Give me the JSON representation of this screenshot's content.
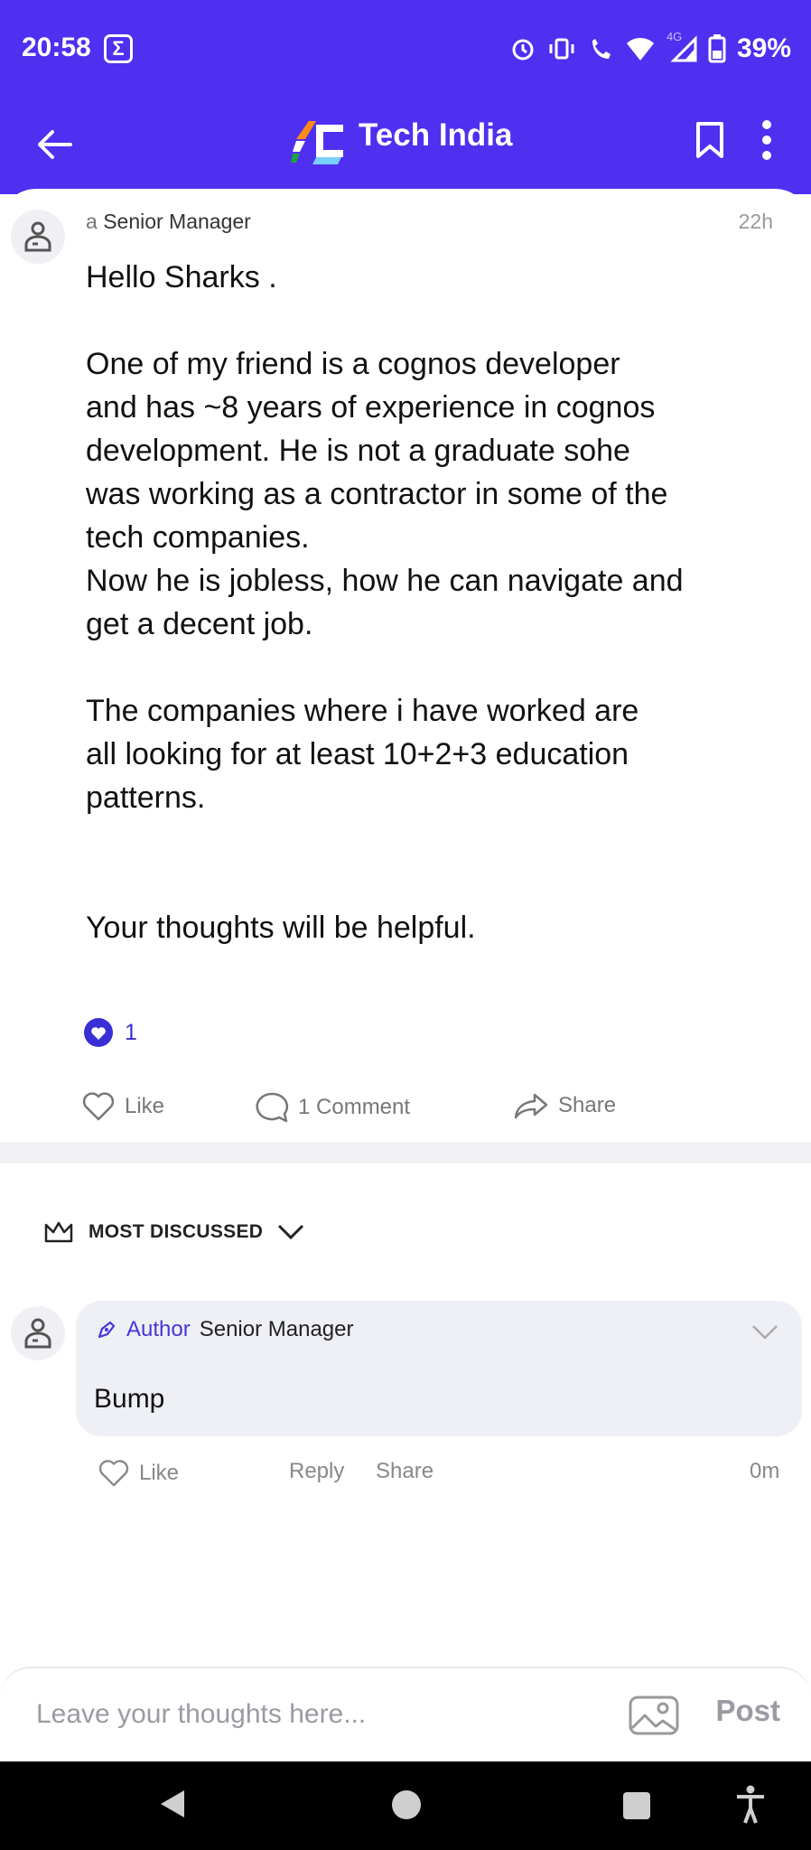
{
  "status_bar": {
    "time": "20:58",
    "notification_icon": "sigma-icon",
    "notification_glyph": "Σ",
    "network_label": "4G",
    "battery": "39%",
    "icons": [
      "alarm-icon",
      "vibrate-icon",
      "wifi-call-icon",
      "wifi-icon",
      "signal-icon",
      "battery-icon"
    ]
  },
  "app_bar": {
    "title": "Tech India",
    "back_icon": "arrow-left-icon",
    "logo_icon": "tech-india-logo",
    "bookmark_icon": "bookmark-icon",
    "menu_icon": "more-vert-icon"
  },
  "post": {
    "author_prefix": "a",
    "author_role": "Senior Manager",
    "time_ago": "22h",
    "body": "Hello Sharks .\n\nOne of my friend is a cognos developer\nand has ~8 years of experience in cognos\ndevelopment. He is not a graduate sohe\nwas working as a contractor in some of the\ntech companies.\nNow he is jobless, how he can navigate and\nget a decent job.\n\nThe companies where i have worked are\nall looking for at least 10+2+3 education\npatterns.\n\n\nYour thoughts will be helpful.",
    "reaction_count": "1",
    "actions": {
      "like": "Like",
      "comment": "1 Comment",
      "share": "Share"
    }
  },
  "comments": {
    "sort_label": "MOST DISCUSSED",
    "items": [
      {
        "tag": "Author",
        "role": "Senior Manager",
        "text": "Bump",
        "like": "Like",
        "reply": "Reply",
        "share": "Share",
        "time_ago": "0m"
      }
    ]
  },
  "composer": {
    "placeholder": "Leave your thoughts here...",
    "post_label": "Post"
  },
  "colors": {
    "brand": "#4f2ff0",
    "accent": "#3a2fd6",
    "muted": "#999999"
  }
}
